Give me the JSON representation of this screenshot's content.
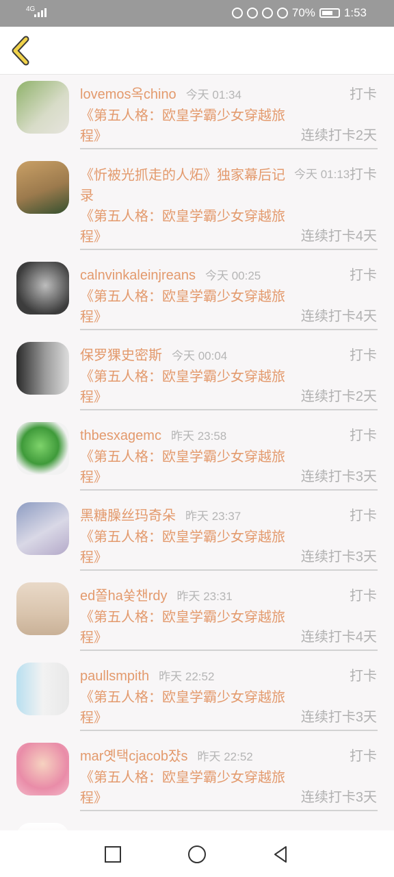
{
  "status_bar": {
    "network": "4G",
    "battery": "70%",
    "time": "1:53",
    "icons": [
      "headset-icon",
      "data-saver-icon",
      "eye-icon",
      "mute-bell-icon",
      "battery-icon"
    ]
  },
  "header": {
    "back_icon": "chevron-left-icon"
  },
  "items": [
    {
      "username": "lovemos옥chino",
      "time": "今天 01:34",
      "action": "打卡",
      "book": "《第五人格：欧皇学霸少女穿越旅程》",
      "streak": "连续打卡2天",
      "avatar": "avatar-photo"
    },
    {
      "username": "《忻被光抓走的人炻》独家幕后记录",
      "time": "今天 01:13",
      "action": "打卡",
      "book": "《第五人格：欧皇学霸少女穿越旅程》",
      "streak": "连续打卡4天",
      "avatar": "avatar-photo"
    },
    {
      "username": "calnvinkaleinjreans",
      "time": "今天 00:25",
      "action": "打卡",
      "book": "《第五人格：欧皇学霸少女穿越旅程》",
      "streak": "连续打卡4天",
      "avatar": "avatar-photo"
    },
    {
      "username": "保罗猓史密斯",
      "time": "今天 00:04",
      "action": "打卡",
      "book": "《第五人格：欧皇学霸少女穿越旅程》",
      "streak": "连续打卡2天",
      "avatar": "avatar-photo"
    },
    {
      "username": "thbesxagemc",
      "time": "昨天 23:58",
      "action": "打卡",
      "book": "《第五人格：欧皇学霸少女穿越旅程》",
      "streak": "连续打卡3天",
      "avatar": "avatar-photo"
    },
    {
      "username": "黑糖臊丝玛奇朵",
      "time": "昨天 23:37",
      "action": "打卡",
      "book": "《第五人格：欧皇学霸少女穿越旅程》",
      "streak": "连续打卡3天",
      "avatar": "avatar-photo"
    },
    {
      "username": "ed쫄ha쑺챈rdy",
      "time": "昨天 23:31",
      "action": "打卡",
      "book": "《第五人格：欧皇学霸少女穿越旅程》",
      "streak": "连续打卡4天",
      "avatar": "avatar-photo"
    },
    {
      "username": "paullsmpith",
      "time": "昨天 22:52",
      "action": "打卡",
      "book": "《第五人格：欧皇学霸少女穿越旅程》",
      "streak": "连续打卡3天",
      "avatar": "avatar-photo"
    },
    {
      "username": "mar옛택cjacob쟜s",
      "time": "昨天 22:52",
      "action": "打卡",
      "book": "《第五人格：欧皇学霸少女穿越旅程》",
      "streak": "连续打卡3天",
      "avatar": "avatar-photo"
    }
  ],
  "nav": {
    "icons": [
      "square-recents-icon",
      "circle-home-icon",
      "triangle-back-icon"
    ]
  }
}
